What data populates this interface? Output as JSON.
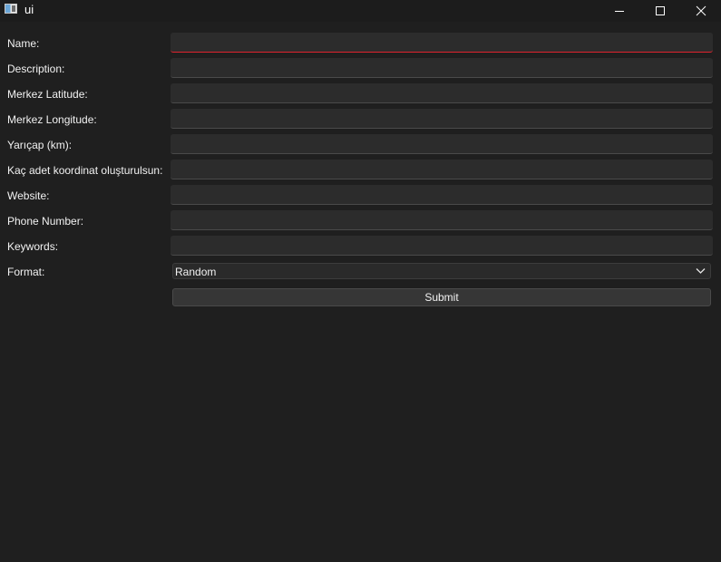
{
  "window": {
    "title": "ui",
    "controls": [
      "minimize-icon",
      "maximize-icon",
      "close-icon"
    ]
  },
  "form": {
    "fields": [
      {
        "label": "Name:",
        "value": "",
        "focused": true
      },
      {
        "label": "Description:",
        "value": ""
      },
      {
        "label": "Merkez Latitude:",
        "value": ""
      },
      {
        "label": "Merkez Longitude:",
        "value": ""
      },
      {
        "label": "Yarıçap (km):",
        "value": ""
      },
      {
        "label": "Kaç adet koordinat oluşturulsun:",
        "value": ""
      },
      {
        "label": "Website:",
        "value": ""
      },
      {
        "label": "Phone Number:",
        "value": ""
      },
      {
        "label": "Keywords:",
        "value": ""
      }
    ],
    "format": {
      "label": "Format:",
      "selected": "Random"
    },
    "submit_label": "Submit"
  },
  "colors": {
    "background": "#1f1f1f",
    "input_background": "#2c2c2c",
    "focus_underline": "#e0232e",
    "text": "#f2f2f2"
  }
}
